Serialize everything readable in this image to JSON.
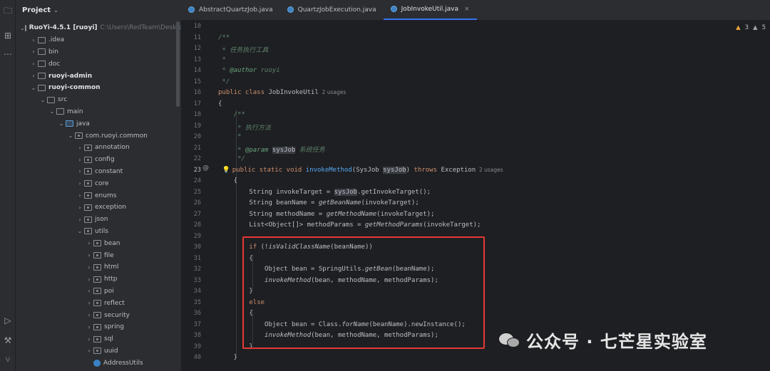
{
  "project_panel": {
    "title": "Project",
    "tree": [
      {
        "label": "RuoYi-4.5.1 [ruoyi]",
        "path": "C:\\Users\\RedTeam\\Desktop",
        "bold": true,
        "indent": 0,
        "open": true
      },
      {
        "label": ".idea",
        "indent": 1
      },
      {
        "label": "bin",
        "indent": 1
      },
      {
        "label": "doc",
        "indent": 1
      },
      {
        "label": "ruoyi-admin",
        "bold": true,
        "indent": 1
      },
      {
        "label": "ruoyi-common",
        "bold": true,
        "indent": 1,
        "open": true
      },
      {
        "label": "src",
        "indent": 2,
        "open": true
      },
      {
        "label": "main",
        "indent": 3,
        "open": true
      },
      {
        "label": "java",
        "indent": 4,
        "open": true,
        "blue": true
      },
      {
        "label": "com.ruoyi.common",
        "indent": 5,
        "open": true,
        "pkg": true
      },
      {
        "label": "annotation",
        "indent": 6,
        "pkg": true
      },
      {
        "label": "config",
        "indent": 6,
        "pkg": true
      },
      {
        "label": "constant",
        "indent": 6,
        "pkg": true
      },
      {
        "label": "core",
        "indent": 6,
        "pkg": true
      },
      {
        "label": "enums",
        "indent": 6,
        "pkg": true
      },
      {
        "label": "exception",
        "indent": 6,
        "pkg": true
      },
      {
        "label": "json",
        "indent": 6,
        "pkg": true
      },
      {
        "label": "utils",
        "indent": 6,
        "pkg": true,
        "open": true
      },
      {
        "label": "bean",
        "indent": 7,
        "pkg": true
      },
      {
        "label": "file",
        "indent": 7,
        "pkg": true
      },
      {
        "label": "html",
        "indent": 7,
        "pkg": true
      },
      {
        "label": "http",
        "indent": 7,
        "pkg": true
      },
      {
        "label": "poi",
        "indent": 7,
        "pkg": true
      },
      {
        "label": "reflect",
        "indent": 7,
        "pkg": true
      },
      {
        "label": "security",
        "indent": 7,
        "pkg": true
      },
      {
        "label": "spring",
        "indent": 7,
        "pkg": true
      },
      {
        "label": "sql",
        "indent": 7,
        "pkg": true
      },
      {
        "label": "uuid",
        "indent": 7,
        "pkg": true
      },
      {
        "label": "AddressUtils",
        "indent": 7,
        "class": true
      }
    ]
  },
  "tabs": [
    {
      "label": "AbstractQuartzJob.java",
      "active": false
    },
    {
      "label": "QuartzJobExecution.java",
      "active": false
    },
    {
      "label": "JobInvokeUtil.java",
      "active": true
    }
  ],
  "inspections": {
    "warnings": "3",
    "weak_warnings": "5"
  },
  "editor": {
    "line_numbers": [
      "10",
      "11",
      "12",
      "13",
      "14",
      "15",
      "16",
      "17",
      "18",
      "19",
      "20",
      "21",
      "22",
      "23",
      "24",
      "25",
      "26",
      "27",
      "28",
      "29",
      "30",
      "31",
      "32",
      "33",
      "34",
      "35",
      "36",
      "37",
      "38",
      "39",
      "40"
    ],
    "current_line": "23",
    "lines": [
      {
        "segments": [
          {
            "t": ""
          }
        ]
      },
      {
        "segments": [
          {
            "t": "/**",
            "c": "doc"
          }
        ]
      },
      {
        "segments": [
          {
            "t": " * 任务执行工具",
            "c": "doc"
          }
        ]
      },
      {
        "segments": [
          {
            "t": " *",
            "c": "doc"
          }
        ]
      },
      {
        "segments": [
          {
            "t": " * ",
            "c": "doc"
          },
          {
            "t": "@author",
            "c": "tag"
          },
          {
            "t": " ruoyi",
            "c": "doc"
          }
        ]
      },
      {
        "segments": [
          {
            "t": " */",
            "c": "doc"
          }
        ]
      },
      {
        "segments": [
          {
            "t": "public class ",
            "c": "kw"
          },
          {
            "t": "JobInvokeUtil"
          },
          {
            "t": "  2 usages",
            "c": "hint"
          }
        ]
      },
      {
        "segments": [
          {
            "t": "{"
          }
        ]
      },
      {
        "segments": [
          {
            "t": "    /**",
            "c": "doc"
          }
        ]
      },
      {
        "segments": [
          {
            "t": "     * 执行方法",
            "c": "doc"
          }
        ]
      },
      {
        "segments": [
          {
            "t": "     *",
            "c": "doc"
          }
        ]
      },
      {
        "segments": [
          {
            "t": "     * ",
            "c": "doc"
          },
          {
            "t": "@param",
            "c": "tag"
          },
          {
            "t": " ",
            "c": "doc"
          },
          {
            "t": "sysJob",
            "c": "hl"
          },
          {
            "t": " 系统任务",
            "c": "doc"
          }
        ]
      },
      {
        "segments": [
          {
            "t": "     */",
            "c": "doc"
          }
        ]
      },
      {
        "segments": [
          {
            "t": "  💡 ",
            "c": "bulb"
          },
          {
            "t": "public static void ",
            "c": "kw"
          },
          {
            "t": "invokeMethod",
            "c": "fn"
          },
          {
            "t": "(SysJob "
          },
          {
            "t": "sysJob",
            "c": "hl"
          },
          {
            "t": ") "
          },
          {
            "t": "throws ",
            "c": "kw"
          },
          {
            "t": "Exception"
          },
          {
            "t": "  2 usages",
            "c": "hint"
          }
        ]
      },
      {
        "segments": [
          {
            "t": "    {"
          }
        ]
      },
      {
        "segments": [
          {
            "t": "        String invokeTarget = "
          },
          {
            "t": "sysJob",
            "c": "hl"
          },
          {
            "t": ".getInvokeTarget();"
          }
        ]
      },
      {
        "segments": [
          {
            "t": "        String beanName = "
          },
          {
            "t": "getBeanName",
            "c": "it"
          },
          {
            "t": "(invokeTarget);"
          }
        ]
      },
      {
        "segments": [
          {
            "t": "        String methodName = "
          },
          {
            "t": "getMethodName",
            "c": "it"
          },
          {
            "t": "(invokeTarget);"
          }
        ]
      },
      {
        "segments": [
          {
            "t": "        List<Object[]> methodParams = "
          },
          {
            "t": "getMethodParams",
            "c": "it"
          },
          {
            "t": "(invokeTarget);"
          }
        ]
      },
      {
        "segments": [
          {
            "t": ""
          }
        ]
      },
      {
        "segments": [
          {
            "t": "        "
          },
          {
            "t": "if ",
            "c": "kw"
          },
          {
            "t": "(!"
          },
          {
            "t": "isValidClassName",
            "c": "it"
          },
          {
            "t": "(beanName))"
          }
        ]
      },
      {
        "segments": [
          {
            "t": "        {"
          }
        ]
      },
      {
        "segments": [
          {
            "t": "            Object bean = SpringUtils."
          },
          {
            "t": "getBean",
            "c": "it"
          },
          {
            "t": "(beanName);"
          }
        ]
      },
      {
        "segments": [
          {
            "t": "            "
          },
          {
            "t": "invokeMethod",
            "c": "it"
          },
          {
            "t": "(bean, methodName, methodParams);"
          }
        ]
      },
      {
        "segments": [
          {
            "t": "        }"
          }
        ]
      },
      {
        "segments": [
          {
            "t": "        "
          },
          {
            "t": "else",
            "c": "kw"
          }
        ]
      },
      {
        "segments": [
          {
            "t": "        {"
          }
        ]
      },
      {
        "segments": [
          {
            "t": "            Object bean = Class."
          },
          {
            "t": "forName",
            "c": "it"
          },
          {
            "t": "(beanName).newInstance();"
          }
        ]
      },
      {
        "segments": [
          {
            "t": "            "
          },
          {
            "t": "invokeMethod",
            "c": "it"
          },
          {
            "t": "(bean, methodName, methodParams);"
          }
        ]
      },
      {
        "segments": [
          {
            "t": "        }"
          }
        ]
      },
      {
        "segments": [
          {
            "t": "    }"
          }
        ]
      }
    ]
  },
  "watermark": {
    "text": "公众号 · 七芒星实验室"
  }
}
